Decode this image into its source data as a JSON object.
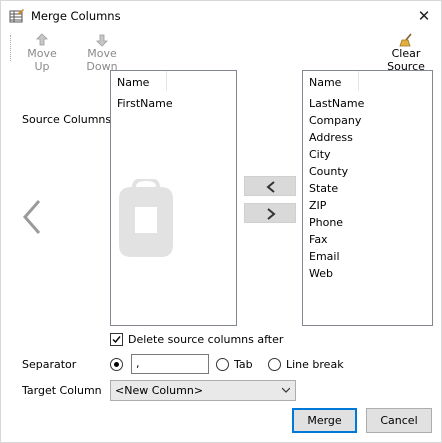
{
  "window": {
    "title": "Merge Columns",
    "close_glyph": "✕"
  },
  "toolbar": {
    "move_up": "Move Up",
    "move_down": "Move Down",
    "clear_source": "Clear Source"
  },
  "source": {
    "label": "Source Columns",
    "header": "Name",
    "items": [
      "FirstName"
    ]
  },
  "available": {
    "header": "Name",
    "items": [
      "LastName",
      "Company",
      "Address",
      "City",
      "County",
      "State",
      "ZIP",
      "Phone",
      "Fax",
      "Email",
      "Web"
    ]
  },
  "options": {
    "delete_label": "Delete source columns after",
    "delete_checked": true,
    "separator_label": "Separator",
    "separator_value": ",",
    "tab_label": "Tab",
    "linebreak_label": "Line break",
    "target_label": "Target Column",
    "target_value": "<New Column>"
  },
  "buttons": {
    "merge": "Merge",
    "cancel": "Cancel"
  },
  "colors": {
    "accent": "#0078d7",
    "disabled_text": "#8a8a8a"
  }
}
